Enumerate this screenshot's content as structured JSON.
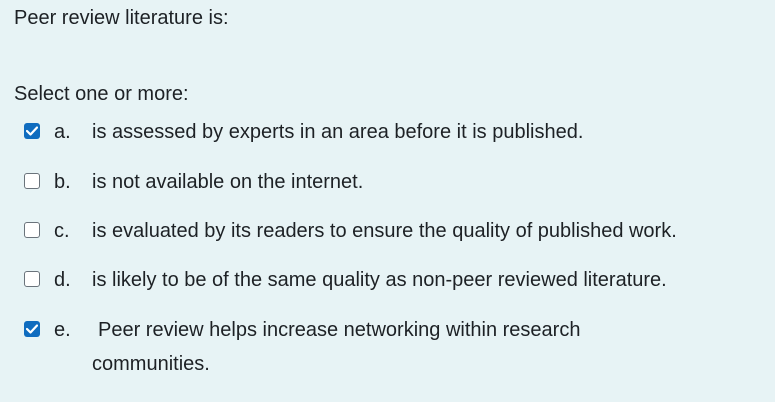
{
  "question": {
    "text": "Peer review literature is:"
  },
  "prompt": "Select one or more:",
  "options": [
    {
      "letter": "a.",
      "text": "is assessed by experts in an area before it is published.",
      "checked": true
    },
    {
      "letter": "b.",
      "text": "is not available on the internet.",
      "checked": false
    },
    {
      "letter": "c.",
      "text": "is evaluated by its readers to ensure the quality of published work.",
      "checked": false
    },
    {
      "letter": "d.",
      "text": "is likely to be of the same quality as non-peer reviewed literature.",
      "checked": false
    },
    {
      "letter": "e.",
      "text": "Peer review helps increase networking within research communities.",
      "checked": true
    }
  ],
  "colors": {
    "background": "#e7f3f5",
    "checkbox_checked": "#0f6cbf",
    "text": "#1d2125"
  }
}
